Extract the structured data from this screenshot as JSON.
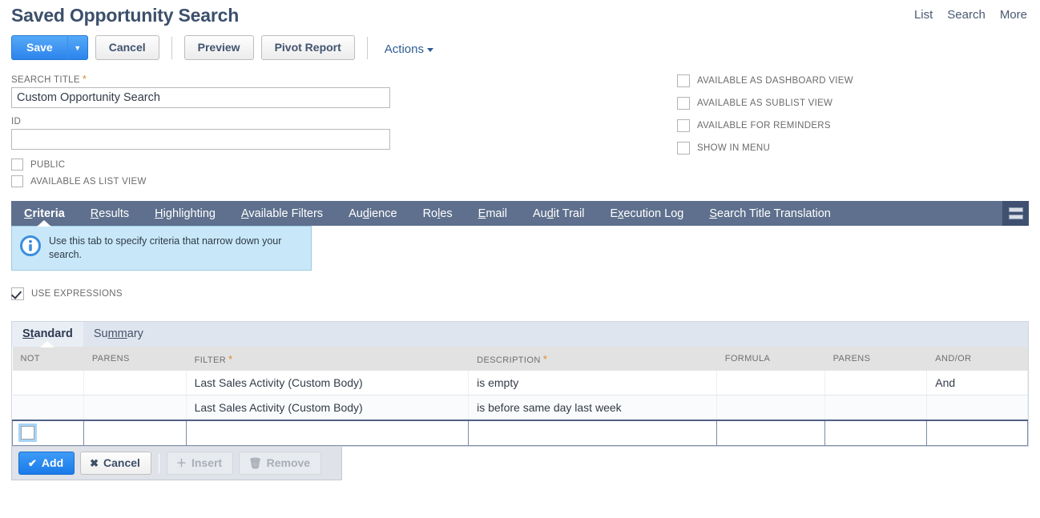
{
  "header": {
    "title": "Saved Opportunity Search",
    "nav": [
      {
        "label": "List"
      },
      {
        "label": "Search"
      },
      {
        "label": "More"
      }
    ]
  },
  "toolbar": {
    "save_label": "Save",
    "save_arrow_glyph": "▼",
    "cancel_label": "Cancel",
    "preview_label": "Preview",
    "pivot_report_label": "Pivot Report",
    "actions_label": "Actions"
  },
  "form": {
    "search_title_label": "SEARCH TITLE",
    "search_title_value": "Custom Opportunity Search",
    "search_title_required": "*",
    "id_label": "ID",
    "id_value": "",
    "id_placeholder": "",
    "left_checkboxes": [
      {
        "label": "PUBLIC",
        "checked": false
      },
      {
        "label": "AVAILABLE AS LIST VIEW",
        "checked": false
      }
    ],
    "right_checkboxes": [
      {
        "label": "AVAILABLE AS DASHBOARD VIEW",
        "checked": false
      },
      {
        "label": "AVAILABLE AS SUBLIST VIEW",
        "checked": false
      },
      {
        "label": "AVAILABLE FOR REMINDERS",
        "checked": false
      },
      {
        "label": "SHOW IN MENU",
        "checked": false
      }
    ]
  },
  "tabs": {
    "items": [
      {
        "pre": "",
        "key": "C",
        "post": "riteria",
        "label": "Criteria",
        "active": true
      },
      {
        "pre": "",
        "key": "R",
        "post": "esults",
        "label": "Results",
        "active": false
      },
      {
        "pre": "",
        "key": "H",
        "post": "ighlighting",
        "label": "Highlighting",
        "active": false
      },
      {
        "pre": "",
        "key": "A",
        "post": "vailable Filters",
        "label": "Available Filters",
        "active": false
      },
      {
        "pre": "Au",
        "key": "d",
        "post": "ience",
        "label": "Audience",
        "active": false
      },
      {
        "pre": "Ro",
        "key": "l",
        "post": "es",
        "label": "Roles",
        "active": false
      },
      {
        "pre": "",
        "key": "E",
        "post": "mail",
        "label": "Email",
        "active": false
      },
      {
        "pre": "Au",
        "key": "d",
        "post": "it Trail",
        "label": "Audit Trail",
        "active": false
      },
      {
        "pre": "E",
        "key": "x",
        "post": "ecution Log",
        "label": "Execution Log",
        "active": false
      },
      {
        "pre": "",
        "key": "S",
        "post": "earch Title Translation",
        "label": "Search Title Translation",
        "active": false
      }
    ],
    "menu_icon": "hamburger-icon"
  },
  "info": {
    "icon": "info-icon",
    "text": "Use this tab to specify criteria that narrow down your search."
  },
  "use_expressions": {
    "label": "USE EXPRESSIONS",
    "checked": true
  },
  "sublist": {
    "subtabs": [
      {
        "pre": "",
        "key": "St",
        "post": "andard",
        "label": "Standard",
        "active": true
      },
      {
        "pre": "Su",
        "key": "mm",
        "post": "ary",
        "label": "Summary",
        "active": false
      }
    ],
    "columns": [
      {
        "label": "NOT",
        "required": ""
      },
      {
        "label": "PARENS",
        "required": ""
      },
      {
        "label": "FILTER",
        "required": "*"
      },
      {
        "label": "DESCRIPTION",
        "required": "*"
      },
      {
        "label": "FORMULA",
        "required": ""
      },
      {
        "label": "PARENS",
        "required": ""
      },
      {
        "label": "AND/OR",
        "required": ""
      }
    ],
    "rows": [
      {
        "not": "",
        "parens_left": "",
        "filter": "Last Sales Activity (Custom Body)",
        "description": "is empty",
        "formula": "",
        "parens_right": "",
        "and_or": "And"
      },
      {
        "not": "",
        "parens_left": "",
        "filter": "Last Sales Activity (Custom Body)",
        "description": "is before same day last week",
        "formula": "",
        "parens_right": "",
        "and_or": ""
      }
    ],
    "edit_row": {
      "not_checked": false,
      "parens_left": "",
      "filter": "",
      "description": "",
      "formula": "",
      "parens_right": "",
      "and_or": ""
    },
    "buttons": [
      {
        "label": "Add",
        "glyph": "✔",
        "state": "primary"
      },
      {
        "label": "Cancel",
        "glyph": "✖",
        "state": "normal"
      },
      {
        "label": "Insert",
        "glyph": "＋",
        "state": "disabled"
      },
      {
        "label": "Remove",
        "glyph": "🗑",
        "state": "disabled"
      }
    ]
  },
  "colors": {
    "title": "#3c4f6b",
    "primary_button": "#2b84ec",
    "tabbar": "#5e708d",
    "info_box": "#c8e8fa",
    "required_star": "#d98a28"
  }
}
